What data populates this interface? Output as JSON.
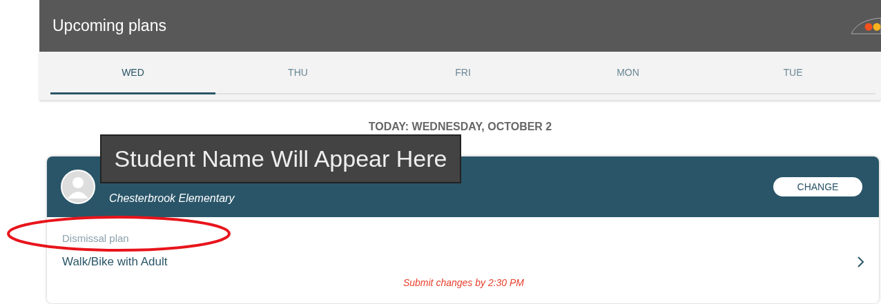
{
  "header": {
    "title": "Upcoming plans"
  },
  "tabs": [
    {
      "label": "WED",
      "selected": true
    },
    {
      "label": "THU",
      "selected": false
    },
    {
      "label": "FRI",
      "selected": false
    },
    {
      "label": "MON",
      "selected": false
    },
    {
      "label": "TUE",
      "selected": false
    }
  ],
  "date_heading": "TODAY: WEDNESDAY, OCTOBER 2",
  "student_card": {
    "school": "Chesterbrook Elementary",
    "change_button": "CHANGE",
    "plan_label": "Dismissal plan",
    "plan_value": "Walk/Bike with Adult",
    "deadline": "Submit changes by 2:30 PM"
  },
  "tooltip": "Student Name Will Appear Here",
  "annotation": {
    "kind": "ellipse",
    "color": "#e8141b"
  }
}
